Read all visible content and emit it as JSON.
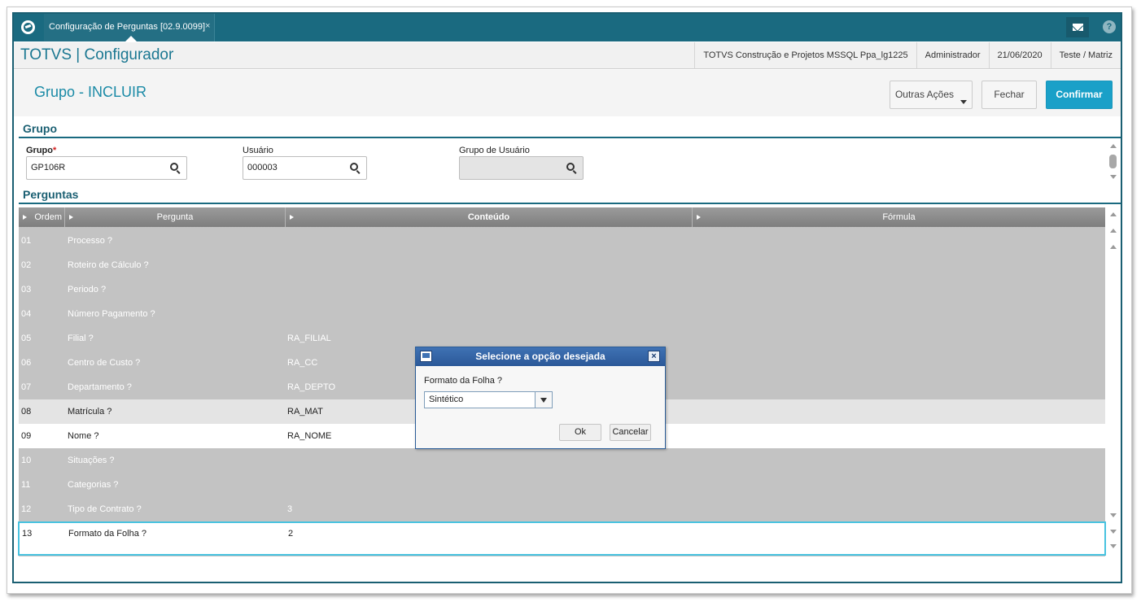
{
  "topbar": {
    "tab_label": "Configuração de Perguntas [02.9.0099]",
    "tab_close": "×",
    "help": "?"
  },
  "header": {
    "brand": "TOTVS | Configurador",
    "info": [
      "TOTVS Construção e Projetos MSSQL Ppa_lg1225",
      "Administrador",
      "21/06/2020",
      "Teste / Matriz"
    ]
  },
  "page": {
    "title": "Grupo - INCLUIR",
    "btn_outras": "Outras Ações",
    "btn_fechar": "Fechar",
    "btn_confirmar": "Confirmar"
  },
  "grupo_section": {
    "title": "Grupo",
    "grupo_label": "Grupo",
    "required_mark": "*",
    "grupo_value": "GP106R",
    "usuario_label": "Usuário",
    "usuario_value": "000003",
    "grupo_usuario_label": "Grupo de Usuário",
    "grupo_usuario_value": ""
  },
  "perguntas_section": {
    "title": "Perguntas",
    "columns": [
      "Ordem",
      "Pergunta",
      "Conteúdo",
      "Fórmula"
    ],
    "rows": [
      {
        "ordem": "01",
        "pergunta": "Processo ?",
        "conteudo": ""
      },
      {
        "ordem": "02",
        "pergunta": "Roteiro de Cálculo ?",
        "conteudo": ""
      },
      {
        "ordem": "03",
        "pergunta": "Periodo ?",
        "conteudo": ""
      },
      {
        "ordem": "04",
        "pergunta": "Número Pagamento ?",
        "conteudo": ""
      },
      {
        "ordem": "05",
        "pergunta": "Filial ?",
        "conteudo": "RA_FILIAL"
      },
      {
        "ordem": "06",
        "pergunta": "Centro de Custo ?",
        "conteudo": "RA_CC"
      },
      {
        "ordem": "07",
        "pergunta": "Departamento ?",
        "conteudo": "RA_DEPTO"
      },
      {
        "ordem": "08",
        "pergunta": "Matrícula ?",
        "conteudo": "RA_MAT"
      },
      {
        "ordem": "09",
        "pergunta": "Nome ?",
        "conteudo": "RA_NOME"
      },
      {
        "ordem": "10",
        "pergunta": "Situações ?",
        "conteudo": ""
      },
      {
        "ordem": "11",
        "pergunta": "Categorias ?",
        "conteudo": ""
      },
      {
        "ordem": "12",
        "pergunta": "Tipo de Contrato ?",
        "conteudo": "3"
      },
      {
        "ordem": "13",
        "pergunta": "Formato da Folha ?",
        "conteudo": "2"
      }
    ]
  },
  "dialog": {
    "title": "Selecione a opção desejada",
    "close": "×",
    "field_label": "Formato da Folha ?",
    "selected_option": "Sintético",
    "ok": "Ok",
    "cancel": "Cancelar"
  },
  "colors": {
    "topbar": "#1a6a80",
    "brand": "#1a7791",
    "confirm": "#1aa0c8",
    "dialog_title": "#2b5898",
    "selected_row_border": "#48c3e0"
  }
}
